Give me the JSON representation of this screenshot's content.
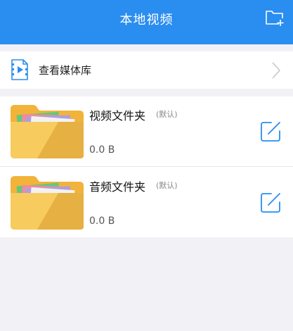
{
  "header": {
    "title": "本地视频",
    "action_icon": "new-folder-icon",
    "background": "#2a8df0"
  },
  "library": {
    "icon": "video-file-icon",
    "label": "查看媒体库",
    "chevron_icon": "chevron-right-icon"
  },
  "folders": [
    {
      "name": "视频文件夹",
      "tag": "(默认)",
      "size": "0.0 B",
      "icon": "folder-icon",
      "edit_icon": "edit-icon"
    },
    {
      "name": "音频文件夹",
      "tag": "(默认)",
      "size": "0.0 B",
      "icon": "folder-icon",
      "edit_icon": "edit-icon"
    }
  ],
  "colors": {
    "accent": "#2a8df0",
    "folder": "#f5c45a",
    "background": "#f2f2f6"
  }
}
